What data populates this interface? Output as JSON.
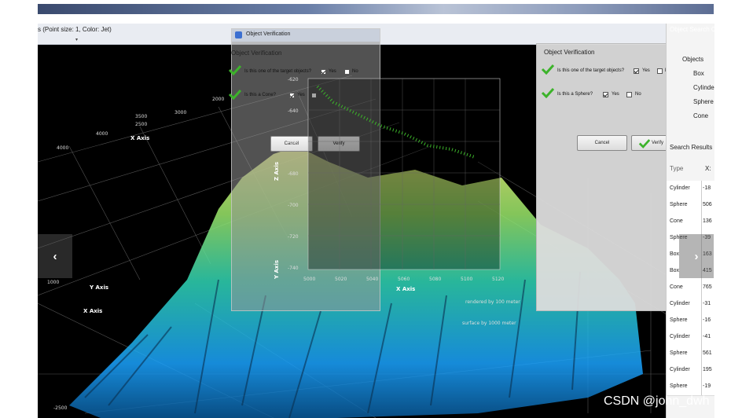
{
  "app": {
    "title": "s (Point size: 1, Color: Jet)",
    "caret": "▾"
  },
  "plot3d": {
    "axis_labels": [
      "X Axis",
      "Y Axis",
      "X Axis"
    ],
    "ticks": [
      "2000",
      "3000",
      "4000",
      "4000",
      "2500",
      "3500",
      "1000",
      "-2500"
    ],
    "footer": "surface by 1000 meter"
  },
  "dialog_left": {
    "title": "Object Verification",
    "section": "Object Verification",
    "q1": "Is this one of the target objects?",
    "q2": "Is this a Cone?",
    "yes": "Yes",
    "no": "No",
    "cancel": "Cancel",
    "verify": "Verify",
    "overlay_numbers": [
      "2000",
      "2500",
      "3000"
    ],
    "y_ticks": [
      "-620",
      "-640",
      "-660",
      "-680",
      "-700",
      "-720",
      "-740"
    ],
    "x_ticks": [
      "5000",
      "5020",
      "5040",
      "5060",
      "5080",
      "5100",
      "5120"
    ],
    "z_axis": "Z Axis",
    "y_axis": "Y Axis",
    "x_axis": "X Axis",
    "scale_note": "rendered by 100 meter"
  },
  "dialog_right": {
    "section": "Object Verification",
    "q1": "Is this one of the target objects?",
    "q2": "Is this a Sphere?",
    "yes": "Yes",
    "no": "No",
    "cancel": "Cancel",
    "verify": "Verify"
  },
  "right_panel": {
    "title": "Object Search C",
    "tree": [
      "Objects",
      "Box",
      "Cylinder",
      "Sphere",
      "Cone"
    ],
    "results_label": "Search Results",
    "col_type": "Type",
    "col_x": "X:",
    "rows": [
      {
        "type": "Cylinder",
        "x": "-18"
      },
      {
        "type": "Sphere",
        "x": "506"
      },
      {
        "type": "Cone",
        "x": "136"
      },
      {
        "type": "Sphere",
        "x": "-39"
      },
      {
        "type": "Box",
        "x": "163"
      },
      {
        "type": "Box",
        "x": "415"
      },
      {
        "type": "Cone",
        "x": "765"
      },
      {
        "type": "Cylinder",
        "x": "-31"
      },
      {
        "type": "Sphere",
        "x": "-16"
      },
      {
        "type": "Cylinder",
        "x": "-41"
      },
      {
        "type": "Sphere",
        "x": "561"
      },
      {
        "type": "Cylinder",
        "x": "195"
      },
      {
        "type": "Sphere",
        "x": "-19"
      }
    ]
  },
  "carousel": {
    "prev": "‹",
    "next": "›"
  },
  "watermark": "CSDN @john_dwh",
  "colors": {
    "bg": "#000000",
    "point_low": "#1aa3ff",
    "point_high": "#e8f76a",
    "check": "#3cb32a"
  }
}
